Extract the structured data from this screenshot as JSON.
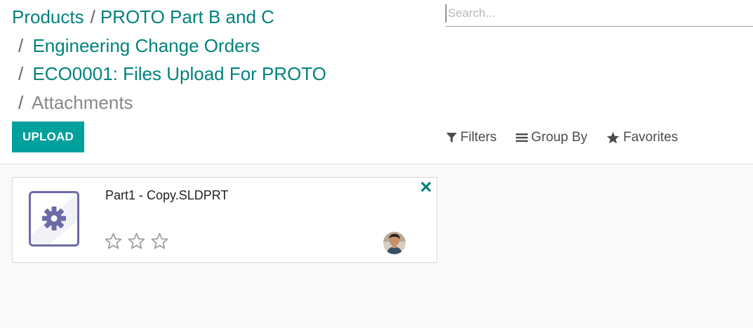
{
  "breadcrumb": {
    "items": [
      "Products",
      "PROTO Part B and C",
      "Engineering Change Orders",
      "ECO0001: Files Upload For PROTO"
    ],
    "current": "Attachments",
    "separator": "/"
  },
  "search": {
    "placeholder": "Search..."
  },
  "toolbar": {
    "upload_label": "UPLOAD"
  },
  "search_options": {
    "filters": "Filters",
    "group_by": "Group By",
    "favorites": "Favorites"
  },
  "attachments": [
    {
      "name": "Part1 - Copy.SLDPRT",
      "rating": 0,
      "max_rating": 3,
      "icon": "gear-icon"
    }
  ],
  "colors": {
    "primary": "#00a09d",
    "link": "#00827c",
    "icon_purple": "#6b6ba6"
  }
}
